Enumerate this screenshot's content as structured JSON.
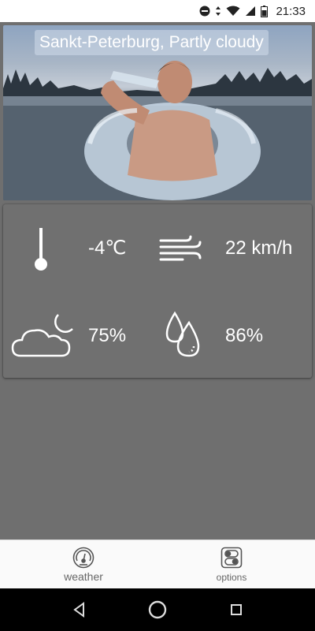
{
  "status_bar": {
    "time": "21:33",
    "icons": [
      "do-not-disturb-icon",
      "data-arrows-icon",
      "wifi-icon",
      "cell-signal-icon",
      "battery-icon"
    ]
  },
  "hero": {
    "title": "Sankt-Peterburg, Partly cloudy"
  },
  "metrics": {
    "temperature": {
      "icon": "thermometer-icon",
      "value": "-4℃"
    },
    "wind": {
      "icon": "wind-icon",
      "value": "22 km/h"
    },
    "cloudiness": {
      "icon": "partly-cloudy-night-icon",
      "value": "75%"
    },
    "humidity": {
      "icon": "humidity-drops-icon",
      "value": "86%"
    }
  },
  "bottom_nav": {
    "items": [
      {
        "label": "weather",
        "icon": "gauge-icon"
      },
      {
        "label": "options",
        "icon": "toggle-switch-icon"
      }
    ]
  },
  "system_nav": {
    "buttons": [
      "back-icon",
      "home-icon",
      "recents-icon"
    ]
  },
  "colors": {
    "background": "#6f6f6f",
    "card": "#707070",
    "text": "#ffffff",
    "nav_bar": "#fafafa",
    "nav_label": "#666666"
  }
}
